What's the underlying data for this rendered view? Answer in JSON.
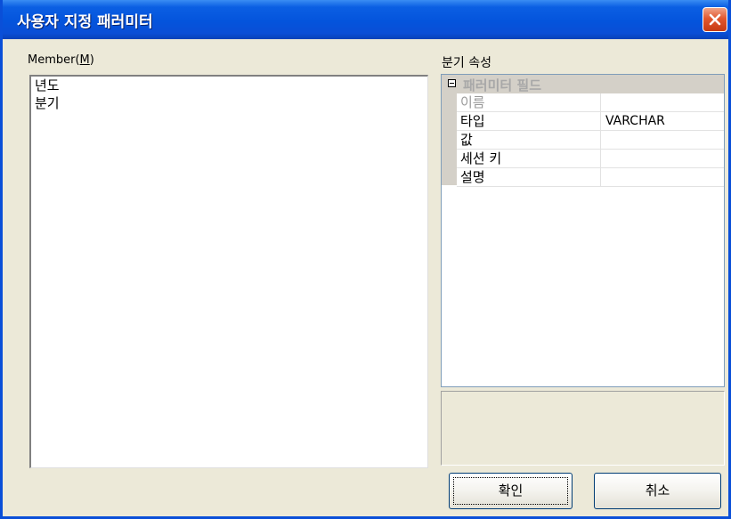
{
  "window": {
    "title": "사용자 지정 패러미터"
  },
  "member": {
    "label_text": "Member(",
    "label_mnemonic": "M",
    "label_close": ")",
    "items": [
      "년도",
      "분기"
    ]
  },
  "properties": {
    "label": "분기 속성",
    "category": "패러미터 필드",
    "rows": [
      {
        "name": "이름",
        "value": "",
        "disabled": true
      },
      {
        "name": "타입",
        "value": "VARCHAR",
        "disabled": false
      },
      {
        "name": "값",
        "value": "",
        "disabled": false
      },
      {
        "name": "세션 키",
        "value": "",
        "disabled": false
      },
      {
        "name": "설명",
        "value": "",
        "disabled": false
      }
    ]
  },
  "buttons": {
    "ok": "확인",
    "cancel": "취소"
  },
  "icons": {
    "close": "close-icon",
    "collapse": "minus-box-icon"
  }
}
